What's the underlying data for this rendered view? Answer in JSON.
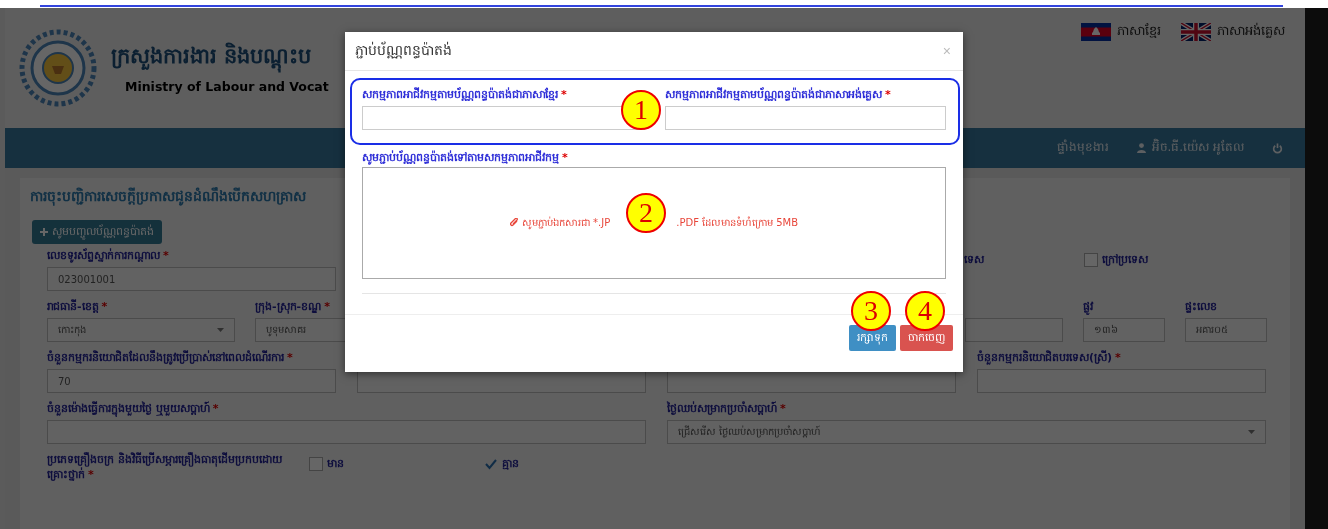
{
  "header": {
    "title_khmer": "ក្រសួងការងារ និងបណ្តុះប",
    "title_english": "Ministry of Labour and Vocat",
    "languages": [
      {
        "label": "ភាសាខ្មែរ",
        "kind": "khmer"
      },
      {
        "label": "ភាសាអង់គ្លេស",
        "kind": "english"
      }
    ]
  },
  "nav": {
    "items": [
      {
        "kind": "link",
        "label": "ផ្ទាំងមុខងារ"
      },
      {
        "kind": "user",
        "label": "អ៊ិច.ធី.យ៉េស អូតែល"
      },
      {
        "kind": "power"
      }
    ]
  },
  "page": {
    "title": "ការចុះបញ្ជិការសេចក្តីប្រកាសជូនដំណឹងបើកសហគ្រាស",
    "add_button": "សូមបញ្ចូលប័ណ្ណពន្ធប៉ាតង់",
    "form": {
      "phone": {
        "label": "លេខទូរស័ព្ទស្នាក់ការកណ្តាល",
        "required_mark": "*",
        "value": "023001001"
      },
      "location_tail": "ទេស",
      "abroad": {
        "label": "ក្រៅប្រទេស",
        "checked": false
      },
      "province": {
        "label": "រាជធានី-ខេត្ត",
        "required_mark": "*",
        "value": "កោះកុង"
      },
      "district": {
        "label": "ក្រុង-ស្រុក-ខណ្ឌ",
        "required_mark": "*",
        "value": "បូទុមសាគរ"
      },
      "street": {
        "label": "ផ្លូវ",
        "value": "១៣៦"
      },
      "house": {
        "label": "ផ្ទះលេខ",
        "value": "អគារ០៥"
      },
      "workers": {
        "label": "ចំនួនកម្មករនិយោជិតដែលនឹងត្រូវប្រើប្រាស់នៅពេលដំណើរការ",
        "required_mark": "*",
        "value": "70"
      },
      "foreign_female": {
        "label": "ចំនួនកម្មករនិយោជិតបរទេស(ស្រី)",
        "required_mark": "*"
      },
      "hours": {
        "label": "ចំនួនម៉ោងធ្វើការក្នុងមួយថ្ងៃ ឬមួយសប្តាហ៍",
        "required_mark": "*"
      },
      "rest_day": {
        "label": "ថ្ងៃឈប់សម្រាកប្រចាំសប្តាហ៍",
        "required_mark": "*",
        "value": "ជ្រើសរើស ថ្ងៃឈប់សម្រាកប្រចាំសប្តាហ៍"
      },
      "machinery": {
        "label": "ប្រភេទគ្រឿងចក្រ និងវិធីប្រើសម្ភារគ្រឿងធាតុដើមប្រកបដោយគ្រោះថ្នាក់",
        "required_mark": "*",
        "options": [
          {
            "label": "មាន",
            "checked": false
          },
          {
            "label": "គ្មាន",
            "checked": true
          }
        ]
      }
    }
  },
  "dialog": {
    "title": "ភ្ជាប់ប័ណ្ណពន្ធប៉ាតង់",
    "close": "×",
    "fields": [
      {
        "label": "សកម្មភាពអាជីវកម្មតាមប័ណ្ណពន្ធប៉ាតង់ជាភាសាខ្មែរ",
        "required_mark": "*"
      },
      {
        "label": "សកម្មភាពអាជីវកម្មតាមប័ណ្ណពន្ធប៉ាតង់ជាភាសាអង់គ្លេស",
        "required_mark": "*"
      }
    ],
    "upload_label": {
      "label": "សូមភ្ជាប់ប័ណ្ណពន្ធប៉ាតង់ទៅតាមសកម្មភាពអាជីវកម្ម",
      "required_mark": "*"
    },
    "upload_hint": [
      "សូមភ្ជាប់ឯកសារជា *.JP",
      ".PDF ដែលមានទំហំក្រោម 5MB"
    ],
    "buttons": [
      {
        "label": "រក្សាទុក",
        "kind": "primary"
      },
      {
        "label": "ចាកចេញ",
        "kind": "danger"
      }
    ]
  },
  "annotations": [
    {
      "label": "1"
    },
    {
      "label": "2"
    },
    {
      "label": "3"
    },
    {
      "label": "4"
    }
  ]
}
